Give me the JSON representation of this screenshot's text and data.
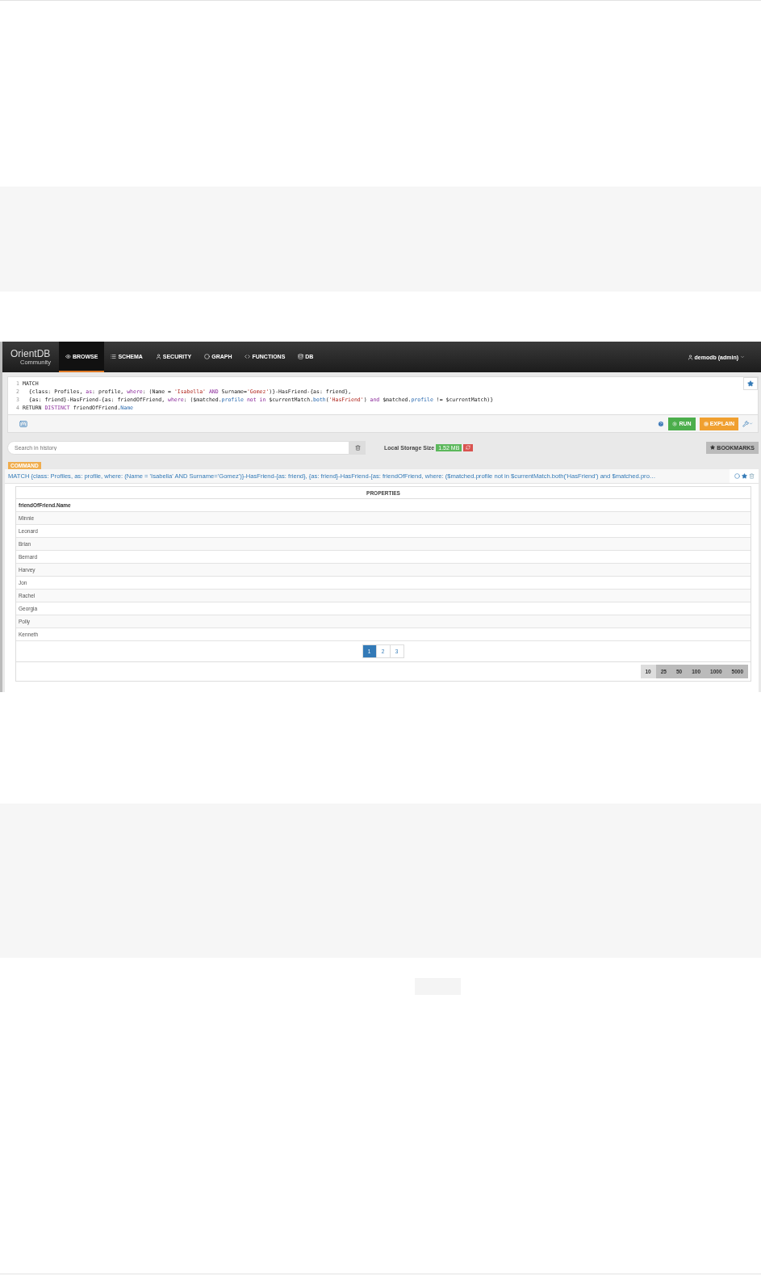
{
  "navbar": {
    "brand": "OrientDB",
    "brand_sub": "Community",
    "tabs": [
      {
        "label": "BROWSE",
        "selected": true
      },
      {
        "label": "SCHEMA",
        "selected": false
      },
      {
        "label": "SECURITY",
        "selected": false
      },
      {
        "label": "GRAPH",
        "selected": false
      },
      {
        "label": "FUNCTIONS",
        "selected": false
      },
      {
        "label": "DB",
        "selected": false
      }
    ],
    "user": "demodb (admin)"
  },
  "editor": {
    "lines": [
      {
        "number": "1",
        "tokens": [
          {
            "kind": "plain",
            "text": "MATCH"
          }
        ]
      },
      {
        "number": "2",
        "tokens": [
          {
            "kind": "plain",
            "text": "  {class: Profiles, "
          },
          {
            "kind": "kw",
            "text": "as"
          },
          {
            "kind": "plain",
            "text": ": profile, "
          },
          {
            "kind": "kw",
            "text": "where"
          },
          {
            "kind": "plain",
            "text": ": (Name = "
          },
          {
            "kind": "str",
            "text": "'Isabella' "
          },
          {
            "kind": "kw",
            "text": "AND"
          },
          {
            "kind": "plain",
            "text": " Surname="
          },
          {
            "kind": "str",
            "text": "'Gomez'"
          },
          {
            "kind": "plain",
            "text": ")}-HasFriend-{as: friend},"
          }
        ]
      },
      {
        "number": "3",
        "tokens": [
          {
            "kind": "plain",
            "text": "  {as: friend}-HasFriend-{as: friendOfFriend, "
          },
          {
            "kind": "kw",
            "text": "where"
          },
          {
            "kind": "plain",
            "text": ": ($matched."
          },
          {
            "kind": "prop",
            "text": "profile "
          },
          {
            "kind": "kw",
            "text": "not in"
          },
          {
            "kind": "plain",
            "text": " $currentMatch."
          },
          {
            "kind": "prop",
            "text": "both"
          },
          {
            "kind": "plain",
            "text": "("
          },
          {
            "kind": "str",
            "text": "'HasFriend'"
          },
          {
            "kind": "plain",
            "text": ") "
          },
          {
            "kind": "kw",
            "text": "and"
          },
          {
            "kind": "plain",
            "text": " $matched."
          },
          {
            "kind": "prop",
            "text": "profile"
          },
          {
            "kind": "plain",
            "text": " != $currentMatch)}"
          }
        ]
      },
      {
        "number": "4",
        "tokens": [
          {
            "kind": "plain",
            "text": "RETURN "
          },
          {
            "kind": "kw",
            "text": "DISTINCT"
          },
          {
            "kind": "plain",
            "text": " friendOfFriend."
          },
          {
            "kind": "prop",
            "text": "Name"
          }
        ]
      }
    ],
    "run": "RUN",
    "explain": "EXPLAIN"
  },
  "history": {
    "placeholder": "Search in history",
    "storage_label": "Local Storage Size",
    "storage_size": "1.52 MB",
    "bookmarks": "BOOKMARKS"
  },
  "result": {
    "badge": "COMMAND",
    "query": "MATCH {class: Profiles, as: profile, where: (Name = 'Isabella' AND Surname='Gomez')}-HasFriend-{as: friend}, {as: friend}-HasFriend-{as: friendOfFriend, where: ($matched.profile not in $currentMatch.both('HasFriend') and $matched.pro…",
    "table_title": "PROPERTIES",
    "column": "friendOfFriend.Name",
    "rows": [
      "Minnie",
      "Leonard",
      "Brian",
      "Bernard",
      "Harvey",
      "Jon",
      "Rachel",
      "Georgia",
      "Polly",
      "Kenneth"
    ],
    "pages": [
      {
        "label": "1",
        "selected": true
      },
      {
        "label": "2",
        "selected": false
      },
      {
        "label": "3",
        "selected": false
      }
    ],
    "page_sizes": [
      {
        "label": "10",
        "selected": true
      },
      {
        "label": "25",
        "selected": false
      },
      {
        "label": "50",
        "selected": false
      },
      {
        "label": "100",
        "selected": false
      },
      {
        "label": "1000",
        "selected": false
      },
      {
        "label": "5000",
        "selected": false
      }
    ]
  }
}
